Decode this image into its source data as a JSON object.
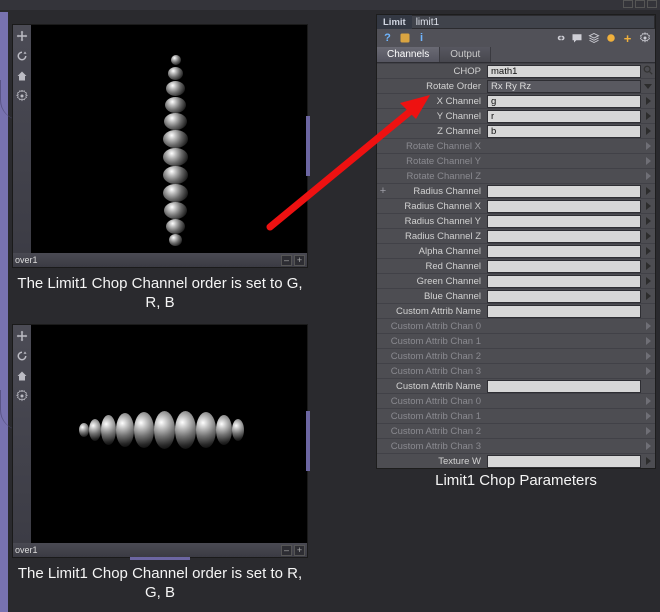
{
  "topstrip": {
    "btn_count": 3
  },
  "viewer1": {
    "status_name": "over1",
    "caption": "The Limit1 Chop Channel order is set to G, R, B"
  },
  "viewer2": {
    "status_name": "over1",
    "caption": "The Limit1 Chop Channel order is set to R, G, B"
  },
  "panel": {
    "operator_type": "Limit",
    "operator_name": "limit1",
    "tabs": {
      "channels": "Channels",
      "output": "Output",
      "active": "Channels"
    },
    "caption": "Limit1 Chop Parameters",
    "chart_data": null
  },
  "params": [
    {
      "label": "CHOP",
      "value": "math1",
      "field": "bright",
      "post": "search",
      "enabled": true,
      "pre": ""
    },
    {
      "label": "Rotate Order",
      "value": "Rx Ry Rz",
      "field": "dark",
      "post": "dropdown",
      "enabled": true,
      "pre": ""
    },
    {
      "label": "X Channel",
      "value": "g",
      "field": "bright",
      "post": "tri",
      "enabled": true,
      "pre": ""
    },
    {
      "label": "Y Channel",
      "value": "r",
      "field": "bright",
      "post": "tri",
      "enabled": true,
      "pre": ""
    },
    {
      "label": "Z Channel",
      "value": "b",
      "field": "bright",
      "post": "tri",
      "enabled": true,
      "pre": ""
    },
    {
      "label": "Rotate Channel X",
      "value": "",
      "field": "none",
      "post": "tri-dim",
      "enabled": false,
      "pre": ""
    },
    {
      "label": "Rotate Channel Y",
      "value": "",
      "field": "none",
      "post": "tri-dim",
      "enabled": false,
      "pre": ""
    },
    {
      "label": "Rotate Channel Z",
      "value": "",
      "field": "none",
      "post": "tri-dim",
      "enabled": false,
      "pre": ""
    },
    {
      "label": "Radius Channel",
      "value": "",
      "field": "bright",
      "post": "tri",
      "enabled": true,
      "pre": "+"
    },
    {
      "label": "Radius Channel X",
      "value": "",
      "field": "bright",
      "post": "tri",
      "enabled": true,
      "pre": ""
    },
    {
      "label": "Radius Channel Y",
      "value": "",
      "field": "bright",
      "post": "tri",
      "enabled": true,
      "pre": ""
    },
    {
      "label": "Radius Channel Z",
      "value": "",
      "field": "bright",
      "post": "tri",
      "enabled": true,
      "pre": ""
    },
    {
      "label": "Alpha Channel",
      "value": "",
      "field": "bright",
      "post": "tri",
      "enabled": true,
      "pre": ""
    },
    {
      "label": "Red Channel",
      "value": "",
      "field": "bright",
      "post": "tri",
      "enabled": true,
      "pre": ""
    },
    {
      "label": "Green Channel",
      "value": "",
      "field": "bright",
      "post": "tri",
      "enabled": true,
      "pre": ""
    },
    {
      "label": "Blue Channel",
      "value": "",
      "field": "bright",
      "post": "tri",
      "enabled": true,
      "pre": ""
    },
    {
      "label": "Custom Attrib Name",
      "value": "",
      "field": "bright",
      "post": "none",
      "enabled": true,
      "pre": ""
    },
    {
      "label": "Custom Attrib Chan 0",
      "value": "",
      "field": "none",
      "post": "tri-dim",
      "enabled": false,
      "pre": ""
    },
    {
      "label": "Custom Attrib Chan 1",
      "value": "",
      "field": "none",
      "post": "tri-dim",
      "enabled": false,
      "pre": ""
    },
    {
      "label": "Custom Attrib Chan 2",
      "value": "",
      "field": "none",
      "post": "tri-dim",
      "enabled": false,
      "pre": ""
    },
    {
      "label": "Custom Attrib Chan 3",
      "value": "",
      "field": "none",
      "post": "tri-dim",
      "enabled": false,
      "pre": ""
    },
    {
      "label": "Custom Attrib Name",
      "value": "",
      "field": "bright",
      "post": "none",
      "enabled": true,
      "pre": ""
    },
    {
      "label": "Custom Attrib Chan 0",
      "value": "",
      "field": "none",
      "post": "tri-dim",
      "enabled": false,
      "pre": ""
    },
    {
      "label": "Custom Attrib Chan 1",
      "value": "",
      "field": "none",
      "post": "tri-dim",
      "enabled": false,
      "pre": ""
    },
    {
      "label": "Custom Attrib Chan 2",
      "value": "",
      "field": "none",
      "post": "tri-dim",
      "enabled": false,
      "pre": ""
    },
    {
      "label": "Custom Attrib Chan 3",
      "value": "",
      "field": "none",
      "post": "tri-dim",
      "enabled": false,
      "pre": ""
    },
    {
      "label": "Texture W",
      "value": "",
      "field": "bright",
      "post": "tri",
      "enabled": true,
      "pre": ""
    }
  ]
}
